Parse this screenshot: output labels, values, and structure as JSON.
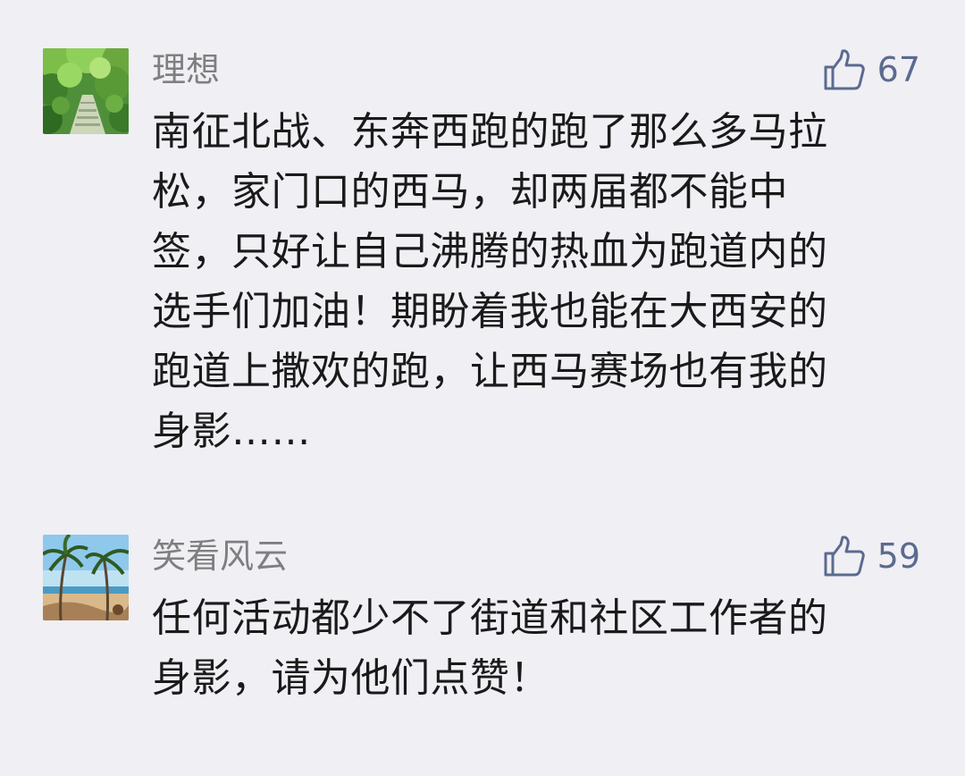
{
  "comments": [
    {
      "author": "理想",
      "avatar_icon": "forest-path-avatar",
      "like_icon": "thumbs-up-icon",
      "likes": "67",
      "lines": [
        "南征北战、东奔西跑的跑了那么多马拉",
        "松，家门口的西马，却两届都不能中",
        "签，只好让自己沸腾的热血为跑道内的",
        "选手们加油！期盼着我也能在大西安的",
        "跑道上撒欢的跑，让西马赛场也有我的",
        "身影……"
      ]
    },
    {
      "author": "笑看风云",
      "avatar_icon": "beach-palm-avatar",
      "like_icon": "thumbs-up-icon",
      "likes": "59",
      "lines": [
        "任何活动都少不了街道和社区工作者的",
        "身影，请为他们点赞！"
      ]
    }
  ],
  "colors": {
    "background": "#f0eff4",
    "author": "#7f7f7f",
    "like": "#5b6b8f",
    "text": "#1a1a1a"
  }
}
